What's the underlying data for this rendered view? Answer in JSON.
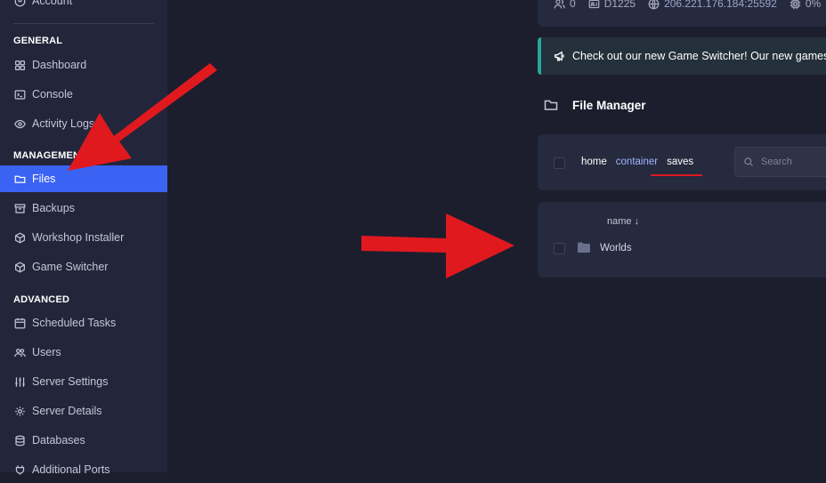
{
  "sidebar": {
    "top_item": "Account",
    "sections": [
      {
        "heading": "GENERAL"
      },
      {
        "heading": "MANAGEMENT"
      },
      {
        "heading": "ADVANCED"
      }
    ],
    "items": [
      {
        "label": "Dashboard",
        "icon": "grid-icon"
      },
      {
        "label": "Console",
        "icon": "terminal-icon"
      },
      {
        "label": "Activity Logs",
        "icon": "eye-icon"
      },
      {
        "label": "Files",
        "icon": "folder-icon",
        "active": true
      },
      {
        "label": "Backups",
        "icon": "archive-icon"
      },
      {
        "label": "Workshop Installer",
        "icon": "box-icon"
      },
      {
        "label": "Game Switcher",
        "icon": "box-icon"
      },
      {
        "label": "Scheduled Tasks",
        "icon": "calendar-icon"
      },
      {
        "label": "Users",
        "icon": "users-icon"
      },
      {
        "label": "Server Settings",
        "icon": "sliders-icon"
      },
      {
        "label": "Server Details",
        "icon": "gear-icon"
      },
      {
        "label": "Databases",
        "icon": "database-icon"
      },
      {
        "label": "Additional Ports",
        "icon": "plug-icon"
      }
    ],
    "active_color": "#3b63f3"
  },
  "stats": {
    "players": "0",
    "server_id": "D1225",
    "address": "206.221.176.184:25592",
    "cpu": "0%"
  },
  "banner": {
    "text": "Check out our new Game Switcher! Our new games c",
    "accent": "#2aa59b"
  },
  "file_manager": {
    "title": "File Manager",
    "breadcrumbs": [
      "home",
      "container",
      "saves"
    ],
    "search_placeholder": "Search",
    "column_header": "name ↓",
    "rows": [
      {
        "name": "Worlds",
        "type": "folder"
      }
    ]
  },
  "annotations": {
    "arrow_color": "#e0191e"
  }
}
